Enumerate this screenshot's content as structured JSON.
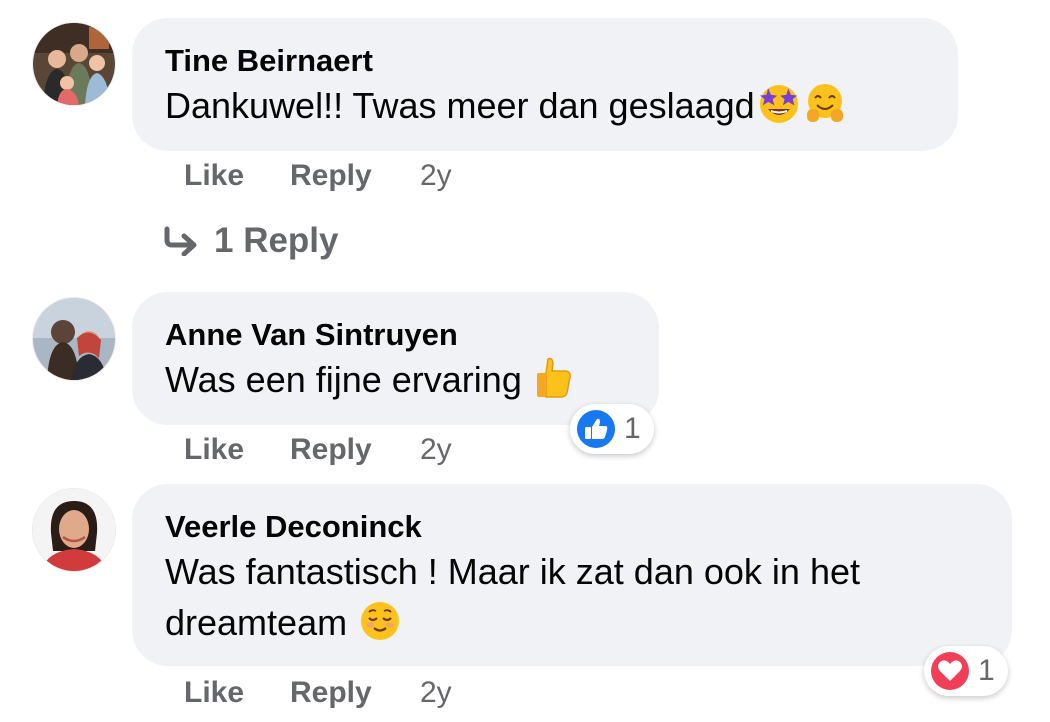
{
  "comments": [
    {
      "author": "Tine Beirnaert",
      "text": "Dankuwel!! Twas meer dan geslaagd",
      "emojis": [
        "star-struck-emoji",
        "hugging-face-emoji"
      ],
      "like_label": "Like",
      "reply_label": "Reply",
      "time": "2y",
      "replies_label": "1 Reply"
    },
    {
      "author": "Anne Van Sintruyen",
      "text": "Was een fijne ervaring",
      "emojis": [
        "thumbs-up-emoji"
      ],
      "like_label": "Like",
      "reply_label": "Reply",
      "time": "2y",
      "reaction": {
        "icon": "like-reaction-icon",
        "count": "1",
        "color": "#1877f2"
      }
    },
    {
      "author": "Veerle Deconinck",
      "text_line1": "Was fantastisch ! Maar ik zat dan ook in het",
      "text_line2": "dreamteam",
      "emojis": [
        "relieved-face-emoji"
      ],
      "like_label": "Like",
      "reply_label": "Reply",
      "time": "2y",
      "reaction": {
        "icon": "love-reaction-icon",
        "count": "1",
        "color": "#f33e58"
      }
    }
  ],
  "colors": {
    "bubble_bg": "#f0f2f5",
    "secondary_text": "#65676b",
    "primary_text": "#050505"
  }
}
